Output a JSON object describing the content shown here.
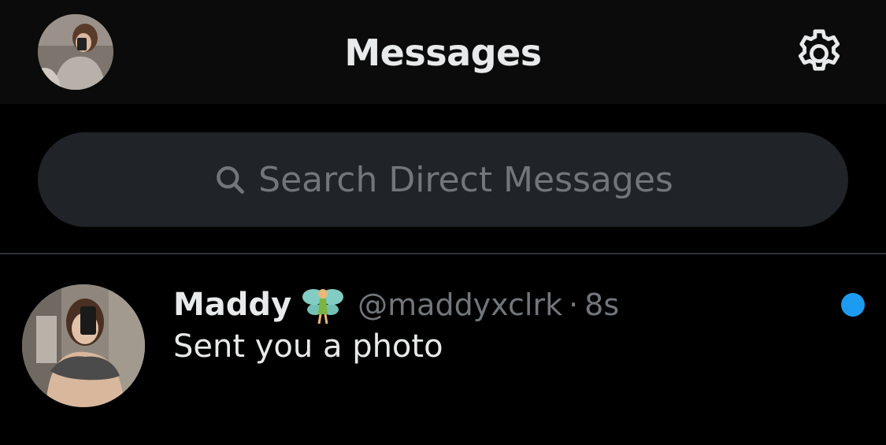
{
  "header": {
    "title": "Messages",
    "avatar_icon": "user-avatar",
    "settings_icon": "gear-icon"
  },
  "search": {
    "placeholder": "Search Direct Messages",
    "icon": "search-icon"
  },
  "conversations": [
    {
      "name": "Maddy",
      "name_emoji_icon": "fairy-emoji-icon",
      "handle": "@maddyxclrk",
      "separator": "·",
      "time": "8s",
      "preview": "Sent you a photo",
      "unread": true
    }
  ],
  "colors": {
    "background": "#000000",
    "header_background": "#0b0b0b",
    "search_background": "#202327",
    "primary_text": "#e7e9ea",
    "secondary_text": "#71767b",
    "unread_dot": "#1d9bf0",
    "divider": "#2f3336"
  }
}
